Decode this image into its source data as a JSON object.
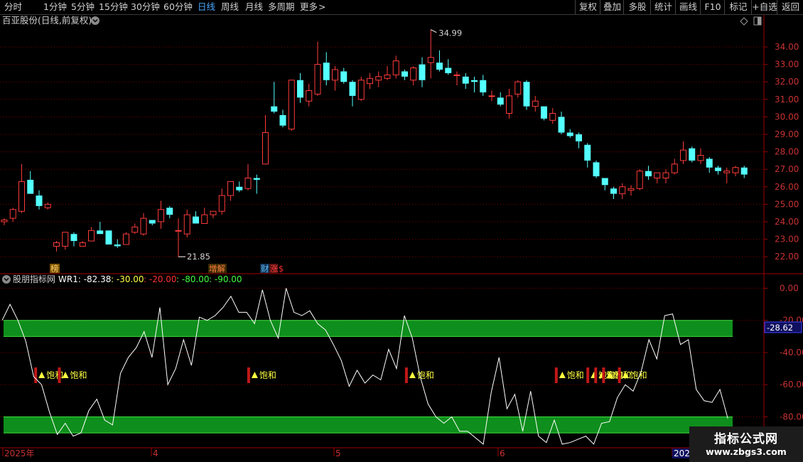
{
  "toolbar": {
    "periods": [
      "分时",
      "1分钟",
      "5分钟",
      "15分钟",
      "30分钟",
      "60分钟",
      "日线",
      "周线",
      "月线",
      "多周期",
      "更多"
    ],
    "active_period": "日线",
    "more_arrow": ">",
    "tools": [
      "复权",
      "叠加",
      "多股",
      "统计",
      "画线",
      "F10",
      "标记",
      "+自选",
      "返回"
    ]
  },
  "stock_title": "百亚股份(日线,前复权)",
  "price_axis_labels": [
    "34.00",
    "33.00",
    "32.00",
    "31.00",
    "30.00",
    "29.00",
    "28.00",
    "27.00",
    "26.00",
    "25.00",
    "24.00",
    "23.00",
    "22.00"
  ],
  "high_label": "34.99",
  "low_label": "21.85",
  "events": [
    {
      "text": "榜",
      "bg": "#7a5200",
      "fg": "#ffd070"
    },
    {
      "text": "增解",
      "bg": "#3a2a00",
      "fg": "#ff8040"
    },
    {
      "text": "财",
      "bg": "#103050",
      "fg": "#60c0ff"
    },
    {
      "text": "涨",
      "bg": "#501010",
      "fg": "#ff4040"
    },
    {
      "text": "$",
      "bg": "#000000",
      "fg": "#ff3030"
    }
  ],
  "indicator": {
    "name": "股朋指标网",
    "wr_label": "WR1: -82.38",
    "levels": [
      ": -30.00",
      ": -20.00",
      ": -80.00",
      ": -90.00"
    ],
    "axis_labels": [
      "0.00",
      "-20.00",
      "-40.00",
      "-60.00",
      "-80.00"
    ],
    "current_value": "-28.62",
    "signal_label": "饱和"
  },
  "date_labels": [
    "2025年",
    "4",
    "5",
    "6",
    "202"
  ],
  "watermark": {
    "line1": "指标公式网",
    "line2": "www.zbgs3.com"
  },
  "colors": {
    "up": "#ff3b3b",
    "down": "#54ffff",
    "grid": "#7a0000",
    "green_band": "#0f9a1e",
    "signal_red": "#c01818",
    "signal_text": "#ffff40"
  },
  "chart_data": {
    "type": "candlestick",
    "ohlc": [
      [
        24.0,
        24.2,
        23.8,
        24.1
      ],
      [
        24.2,
        24.8,
        24.0,
        24.7
      ],
      [
        24.6,
        27.3,
        24.5,
        26.3
      ],
      [
        26.4,
        26.9,
        25.9,
        25.6
      ],
      [
        25.5,
        25.8,
        24.7,
        24.9
      ],
      [
        24.8,
        25.1,
        24.7,
        25.0
      ],
      [
        22.6,
        22.9,
        22.3,
        22.8
      ],
      [
        22.6,
        23.4,
        22.4,
        23.4
      ],
      [
        23.3,
        23.4,
        22.6,
        22.9
      ],
      [
        22.6,
        22.9,
        22.6,
        22.8
      ],
      [
        22.9,
        23.7,
        22.9,
        23.5
      ],
      [
        23.5,
        24.0,
        23.4,
        23.3
      ],
      [
        23.5,
        23.5,
        22.7,
        22.7
      ],
      [
        22.7,
        23.0,
        22.5,
        22.6
      ],
      [
        22.7,
        23.4,
        22.7,
        23.3
      ],
      [
        23.4,
        23.9,
        23.3,
        23.7
      ],
      [
        23.3,
        24.5,
        23.2,
        24.2
      ],
      [
        24.1,
        24.1,
        23.8,
        23.9
      ],
      [
        24.0,
        25.2,
        23.6,
        24.7
      ],
      [
        24.8,
        24.9,
        24.2,
        24.4
      ],
      [
        23.5,
        24.2,
        22.0,
        23.5
      ],
      [
        23.3,
        24.7,
        23.1,
        24.4
      ],
      [
        24.3,
        24.6,
        23.9,
        23.9
      ],
      [
        23.9,
        24.8,
        23.9,
        24.4
      ],
      [
        24.4,
        24.6,
        24.2,
        24.6
      ],
      [
        24.6,
        25.9,
        24.4,
        25.5
      ],
      [
        25.5,
        26.3,
        25.2,
        26.3
      ],
      [
        26.0,
        26.3,
        25.7,
        25.8
      ],
      [
        25.9,
        27.3,
        25.8,
        26.5
      ],
      [
        26.5,
        26.7,
        25.6,
        26.4
      ],
      [
        27.3,
        30.1,
        27.3,
        29.1
      ],
      [
        30.6,
        32.0,
        30.2,
        30.3
      ],
      [
        30.1,
        30.4,
        29.4,
        29.5
      ],
      [
        29.3,
        32.0,
        29.2,
        32.1
      ],
      [
        32.1,
        32.5,
        30.8,
        31.1
      ],
      [
        30.9,
        31.9,
        30.6,
        31.5
      ],
      [
        31.3,
        34.3,
        31.2,
        33.0
      ],
      [
        33.1,
        33.7,
        31.8,
        32.1
      ],
      [
        32.1,
        32.9,
        31.5,
        32.7
      ],
      [
        32.6,
        32.8,
        31.9,
        32.0
      ],
      [
        32.0,
        32.1,
        30.6,
        31.2
      ],
      [
        31.0,
        32.3,
        30.9,
        32.1
      ],
      [
        31.9,
        32.5,
        31.6,
        32.2
      ],
      [
        32.1,
        32.6,
        31.7,
        32.3
      ],
      [
        32.2,
        32.9,
        32.1,
        32.4
      ],
      [
        32.4,
        33.5,
        32.2,
        33.2
      ],
      [
        32.6,
        32.7,
        32.1,
        32.3
      ],
      [
        32.1,
        32.9,
        31.8,
        32.8
      ],
      [
        33.0,
        33.4,
        31.7,
        32.1
      ],
      [
        33.1,
        34.99,
        32.2,
        33.4
      ],
      [
        33.1,
        33.8,
        32.6,
        32.7
      ],
      [
        32.8,
        33.3,
        32.4,
        32.5
      ],
      [
        32.4,
        32.6,
        31.8,
        32.4
      ],
      [
        32.3,
        32.5,
        31.6,
        31.9
      ],
      [
        32.1,
        32.3,
        31.4,
        32.0
      ],
      [
        32.1,
        32.4,
        31.2,
        31.4
      ],
      [
        31.2,
        31.5,
        30.9,
        31.2
      ],
      [
        31.1,
        31.4,
        30.6,
        30.7
      ],
      [
        30.2,
        31.6,
        29.9,
        31.2
      ],
      [
        31.3,
        32.1,
        31.1,
        32.0
      ],
      [
        32.0,
        32.1,
        30.4,
        30.6
      ],
      [
        30.6,
        31.2,
        30.3,
        30.9
      ],
      [
        30.6,
        30.6,
        29.8,
        29.9
      ],
      [
        29.8,
        30.5,
        29.6,
        30.2
      ],
      [
        30.0,
        30.3,
        29.0,
        29.1
      ],
      [
        29.1,
        29.3,
        28.8,
        28.9
      ],
      [
        29.0,
        29.1,
        28.2,
        28.6
      ],
      [
        28.4,
        28.5,
        27.1,
        27.5
      ],
      [
        27.4,
        27.5,
        26.5,
        26.6
      ],
      [
        26.5,
        26.5,
        25.8,
        26.1
      ],
      [
        25.9,
        26.0,
        25.3,
        25.6
      ],
      [
        25.6,
        26.2,
        25.3,
        26.0
      ],
      [
        25.8,
        26.1,
        25.5,
        25.9
      ],
      [
        25.9,
        27.0,
        25.8,
        26.9
      ],
      [
        26.9,
        27.2,
        26.4,
        26.6
      ],
      [
        26.5,
        26.8,
        26.2,
        26.8
      ],
      [
        26.5,
        27.0,
        26.2,
        26.8
      ],
      [
        26.8,
        27.6,
        26.7,
        27.3
      ],
      [
        27.5,
        28.6,
        27.3,
        28.1
      ],
      [
        28.2,
        28.3,
        27.4,
        27.5
      ],
      [
        27.5,
        28.2,
        27.3,
        27.8
      ],
      [
        27.6,
        27.7,
        26.8,
        27.1
      ],
      [
        27.1,
        27.2,
        26.7,
        26.9
      ],
      [
        26.8,
        27.1,
        26.2,
        26.9
      ],
      [
        26.8,
        27.2,
        26.6,
        27.1
      ],
      [
        27.1,
        27.2,
        26.5,
        26.7
      ]
    ],
    "wr": [
      -20,
      -10,
      -20,
      -33,
      -55,
      -60,
      -77,
      -91,
      -84,
      -92,
      -90,
      -76,
      -69,
      -82,
      -85,
      -53,
      -43,
      -37,
      -27,
      -43,
      -12,
      -60,
      -50,
      -32,
      -48,
      -18,
      -20,
      -17,
      -12,
      -5,
      -15,
      -15,
      -22,
      -1,
      -20,
      -31,
      0,
      -15,
      -17,
      -14,
      -22,
      -26,
      -35,
      -45,
      -61,
      -51,
      -59,
      -54,
      -57,
      -38,
      -50,
      -17,
      -31,
      -55,
      -72,
      -80,
      -84,
      -80,
      -89,
      -89,
      -93,
      -97,
      -65,
      -43,
      -75,
      -66,
      -89,
      -64,
      -92,
      -96,
      -82,
      -97,
      -96,
      -94,
      -92,
      -97,
      -84,
      -83,
      -68,
      -60,
      -64,
      -52,
      -32,
      -44,
      -17,
      -16,
      -35,
      -32,
      -63,
      -70,
      -71,
      -63,
      -81
    ],
    "wr_range": [
      -100,
      4
    ],
    "reference_lines": [
      -30,
      -20,
      -80,
      -90
    ],
    "signals_wr_index": [
      2,
      5,
      29,
      49,
      68,
      72,
      73,
      74,
      76
    ],
    "price_range": [
      21.5,
      35.2
    ]
  }
}
